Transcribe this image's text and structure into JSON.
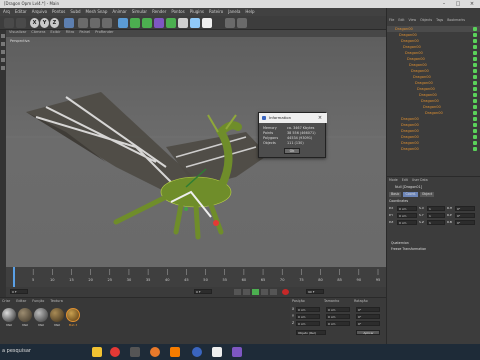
{
  "window": {
    "title": "[Dragon Opm Lvl4.*] - Main",
    "app_label": "R19"
  },
  "menu": [
    "Arquivo",
    "Arquivo",
    "Arquivo",
    "Seleção",
    "Ferramentas",
    "Mesh",
    "Snap",
    "Animar",
    "Simular",
    "Render",
    "Esculpir",
    "Motion Tracker",
    "MoGraph",
    "Personagem",
    "Pipeline",
    "Plugins",
    "Roteiro",
    "Janela",
    "Ajuda"
  ],
  "menu_visible": [
    "Arq",
    "Editar",
    "Arquivo",
    "Pontos",
    "Subd",
    "Mesh Snap",
    "Animar",
    "Simular",
    "Render",
    "Pontos",
    "Plugins",
    "Roteiro",
    "Janela",
    "Help"
  ],
  "toolbar": {
    "axes": [
      "X",
      "Y",
      "Z"
    ]
  },
  "viewport": {
    "menu": [
      "Visualizar",
      "Câmera",
      "Exibir",
      "Filtro",
      "Painel",
      "ProRender"
    ],
    "label": "Perspectiva",
    "grid_info": "Espaçamento da Grade : 1000 cm"
  },
  "dialog": {
    "title": "Information",
    "rows": [
      {
        "label": "Memory",
        "value": "ca. 3467 Kbytes"
      },
      {
        "label": "Points",
        "value": "38 556 (466071)"
      },
      {
        "label": "Polygons",
        "value": "44534 (93091)"
      },
      {
        "label": "Objects",
        "value": "111 (130)"
      }
    ],
    "ok_label": "Ok"
  },
  "timeline": {
    "ticks": [
      "0",
      "5",
      "10",
      "15",
      "20",
      "25",
      "30",
      "35",
      "40",
      "45",
      "50",
      "55",
      "60",
      "65",
      "70",
      "75",
      "80",
      "85",
      "90",
      "95"
    ],
    "frame_start": "0 F",
    "frame_end": "90 F",
    "current": "0 F"
  },
  "materials": {
    "menu": [
      "Criar",
      "Editar",
      "Função",
      "Textura"
    ],
    "items": [
      "Mat",
      "Mat",
      "Mat",
      "Mat",
      "Mat.3"
    ]
  },
  "coords": {
    "headers": [
      "Posição",
      "Tamanho",
      "Rotação"
    ],
    "rows": [
      [
        "0 cm",
        "0 cm",
        "0°"
      ],
      [
        "0 cm",
        "0 cm",
        "0°"
      ],
      [
        "0 cm",
        "0 cm",
        "0°"
      ]
    ],
    "labels": [
      "X",
      "Y",
      "Z"
    ],
    "mode": "Objeto (Rel)",
    "apply": "Aplicar"
  },
  "right": {
    "menu": [
      "File",
      "Edit",
      "View",
      "Objects",
      "Tags",
      "Bookmarks"
    ],
    "objects": [
      "Dragon00",
      "Dragon00",
      "Dragon00",
      "Dragon00",
      "Dragon00",
      "Dragon00",
      "Dragon00",
      "Dragon00",
      "Dragon00",
      "Dragon00",
      "Dragon00",
      "Dragon00",
      "Dragon00",
      "Dragon00",
      "Dragon00",
      "Dragon00",
      "Dragon00",
      "Dragon00",
      "Dragon00",
      "Dragon00",
      "Dragon00"
    ],
    "attr_tabs": [
      "Mode",
      "Edit",
      "User Data"
    ],
    "attr_title": "Null [Dragon01]",
    "attr_subtabs": [
      "Basic",
      "Coord.",
      "Object"
    ],
    "section": "Coordinates",
    "fields": [
      "P.X",
      "P.Y",
      "P.Z",
      "S.X",
      "S.Y",
      "S.Z",
      "R.H",
      "R.P",
      "R.B"
    ],
    "values": [
      "0 cm",
      "0 cm",
      "0 cm",
      "1",
      "1",
      "1",
      "0°",
      "0°",
      "0°"
    ],
    "quaternion": "Quaternion",
    "freeze": "Freeze Transformation"
  },
  "taskbar": {
    "search": "a pesquisar"
  },
  "colors": {
    "accent": "#e09030",
    "panel": "#3c3c3c",
    "viewport": "#666666"
  }
}
